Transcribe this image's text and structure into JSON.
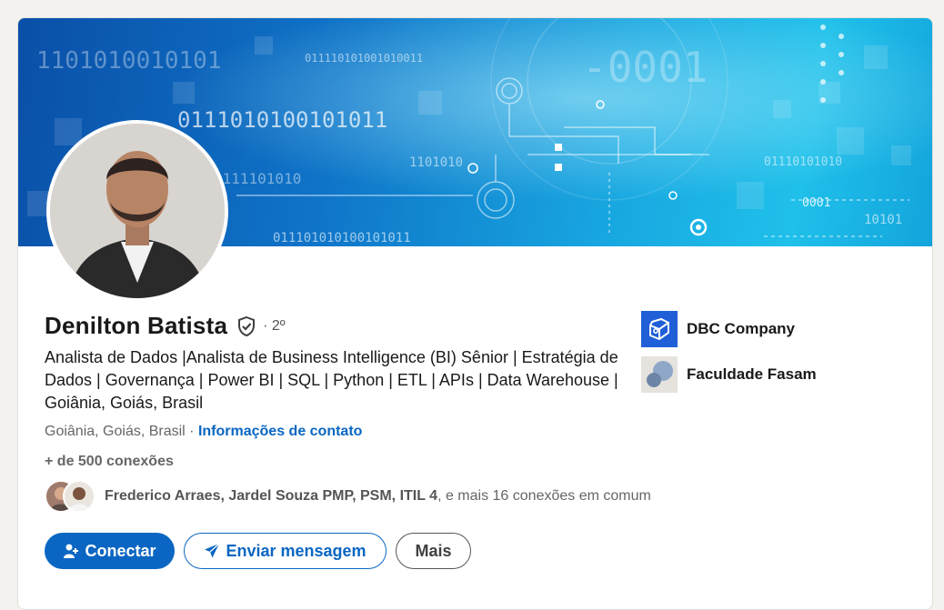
{
  "profile": {
    "name": "Denilton Batista",
    "degree": "· 2º",
    "headline": "Analista de Dados |Analista de Business Intelligence (BI) Sênior | Estratégia de Dados | Governança | Power BI | SQL | Python | ETL | APIs | Data Warehouse | Goiânia, Goiás, Brasil",
    "location": "Goiânia, Goiás, Brasil",
    "location_sep": " · ",
    "contact_link": "Informações de contato",
    "connections_count": "+ de 500",
    "connections_label": " conexões",
    "mutual": {
      "names": "Frederico Arraes, Jardel Souza PMP, PSM, ITIL 4",
      "rest": ", e mais 16 conexões em comum"
    }
  },
  "banner": {
    "binary_1": "1101010010101",
    "binary_2": "011110101001010011",
    "binary_3": "0111010100101011",
    "binary_4": "-0001",
    "binary_5": "0001",
    "binary_6": "011101010100101011",
    "binary_7": "1101010",
    "binary_8": "0111101010",
    "binary_9": "10101",
    "binary_10": "01110101010"
  },
  "actions": {
    "connect": "Conectar",
    "message": "Enviar mensagem",
    "more": "Mais"
  },
  "side": {
    "items": [
      {
        "label": "DBC Company",
        "logo": "dbc-logo"
      },
      {
        "label": "Faculdade Fasam",
        "logo": "fasam-logo"
      }
    ]
  },
  "colors": {
    "accent": "#0a66c2",
    "background": "#f4f2ee",
    "dbc_brand": "#1f5fd8"
  }
}
